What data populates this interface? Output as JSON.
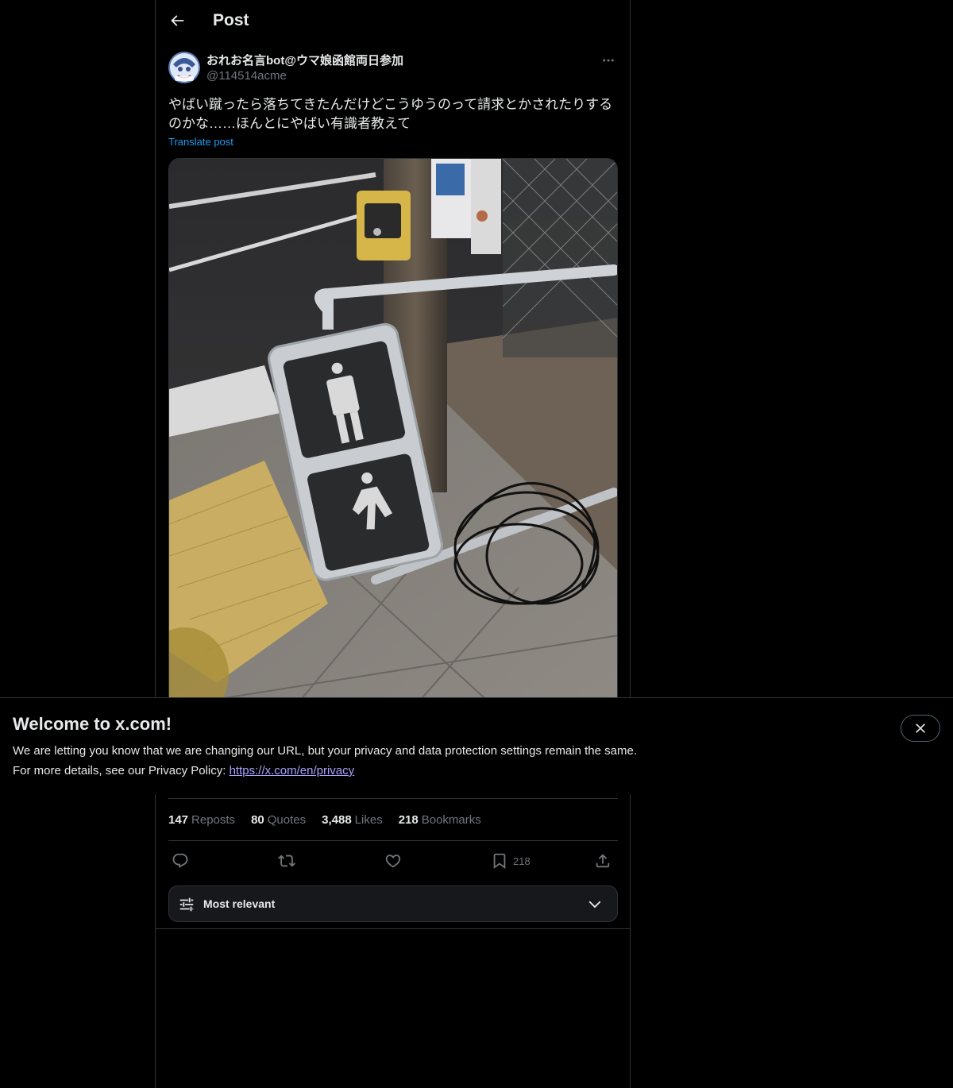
{
  "header": {
    "title": "Post"
  },
  "author": {
    "display_name": "おれお名言bot@ウマ娘函館両日参加",
    "handle": "@114514acme"
  },
  "post": {
    "text_line1": "やばい蹴ったら落ちてきたんだけどこうゆうのって請求とかされたりする",
    "text_line2": "のかな……ほんとにやばい有識者教えて",
    "translate_label": "Translate post"
  },
  "stats": {
    "reposts_count": "147",
    "reposts_label": "Reposts",
    "quotes_count": "80",
    "quotes_label": "Quotes",
    "likes_count": "3,488",
    "likes_label": "Likes",
    "bookmarks_count": "218",
    "bookmarks_label": "Bookmarks"
  },
  "actions": {
    "bookmark_count": "218"
  },
  "sort": {
    "label": "Most relevant"
  },
  "banner": {
    "title": "Welcome to x.com!",
    "line1": "We are letting you know that we are changing our URL, but your privacy and data protection settings remain the same.",
    "line2_prefix": "For more details, see our Privacy Policy: ",
    "link": "https://x.com/en/privacy"
  },
  "colors": {
    "accent": "#1d9bf0",
    "link_visited": "#a8a2ff",
    "secondary_text": "#71767b",
    "border": "#2f3336"
  },
  "icons": [
    "back-arrow-icon",
    "more-icon",
    "reply-icon",
    "repost-icon",
    "like-icon",
    "bookmark-icon",
    "share-icon",
    "sort-sliders-icon",
    "chevron-down-icon",
    "close-icon"
  ]
}
